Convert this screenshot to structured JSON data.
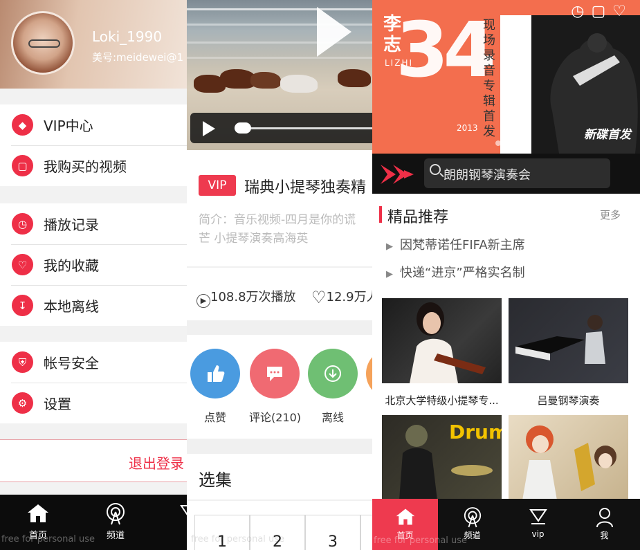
{
  "panel1": {
    "profile": {
      "username": "Loki_1990",
      "meipai_id": "美号:meidewei@1"
    },
    "menu_group1": [
      {
        "label": "VIP中心",
        "icon": "diamond-icon"
      },
      {
        "label": "我购买的视频",
        "icon": "ticket-icon"
      }
    ],
    "menu_group2": [
      {
        "label": "播放记录",
        "icon": "clock-icon"
      },
      {
        "label": "我的收藏",
        "icon": "heart-icon"
      },
      {
        "label": "本地离线",
        "icon": "download-icon"
      }
    ],
    "menu_group3": [
      {
        "label": "帐号安全",
        "icon": "shield-icon"
      },
      {
        "label": "设置",
        "icon": "gear-icon"
      }
    ],
    "logout_label": "退出登录",
    "tabbar": {
      "home": "首页",
      "channel": "频道"
    },
    "watermark": "free for personal use"
  },
  "panel2": {
    "vip_badge": "VIP",
    "title": "瑞典小提琴独奏精",
    "intro_line1": "简介：音乐视频-四月是你的谎",
    "intro_line2": "芒 小提琴演奏高海英",
    "plays": "108.8万次播放",
    "likes": "12.9万人",
    "actions": [
      {
        "label": "点赞",
        "icon": "thumbs-up-icon",
        "color": "#4a9be0"
      },
      {
        "label": "评论(210)",
        "icon": "comment-icon",
        "color": "#f06a72"
      },
      {
        "label": "离线",
        "icon": "download-icon",
        "color": "#6fbf73"
      }
    ],
    "episodes_title": "选集",
    "episodes": [
      "1",
      "2",
      "3"
    ],
    "watermark": "free for personal use"
  },
  "panel3": {
    "banner": {
      "artist": "李志",
      "latin": "LIZHI",
      "number": "34",
      "vertical_text": "现场录音专辑首发",
      "year": "2013",
      "tag": "新碟首发"
    },
    "search_placeholder": "朗朗钢琴演奏会",
    "recommend_title": "精品推荐",
    "more_label": "更多",
    "news": [
      "因梵蒂诺任FIFA新主席",
      "快递“进京”严格实名制"
    ],
    "cards": [
      {
        "caption": "北京大学特级小提琴专..."
      },
      {
        "caption": "吕曼钢琴演奏"
      }
    ],
    "drums_text": "Drums",
    "tabbar": {
      "home": "首页",
      "channel": "频道",
      "vip": "vip",
      "me": "我"
    },
    "watermark": "free for personal use",
    "colors": {
      "accent": "#ee3a4f",
      "banner": "#f36e4e"
    }
  }
}
